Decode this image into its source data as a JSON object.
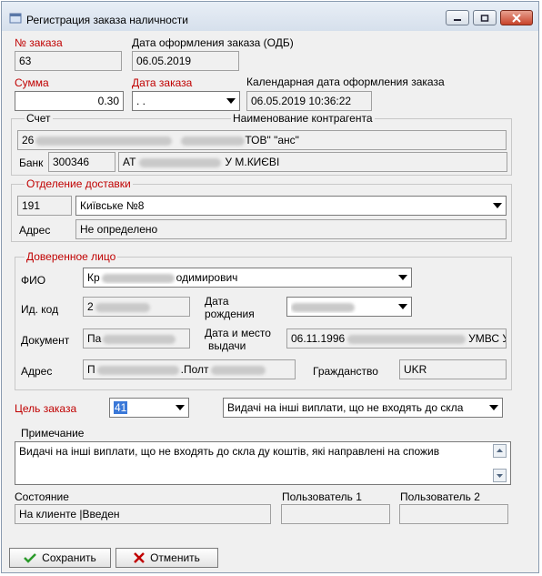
{
  "window": {
    "title": "Регистрация заказа наличности"
  },
  "order": {
    "number_label": "№ заказа",
    "number": "63",
    "odb_date_label": "Дата оформления заказа (ОДБ)",
    "odb_date": "06.05.2019",
    "sum_label": "Сумма",
    "sum": "0.30",
    "date_label": "Дата заказа",
    "date": ". .",
    "calendar_date_label": "Календарная дата оформления заказа",
    "calendar_date": "06.05.2019 10:36:22"
  },
  "account": {
    "legend": "Счет",
    "counterparty_label": "Наименование контрагента",
    "number_visible": "26",
    "counterparty_suffix": "ТОВ\" \"анс\"",
    "bank_label": "Банк",
    "bank_code": "300346",
    "bank_name_prefix": "АТ",
    "bank_name_suffix": "У М.КИЄВІ"
  },
  "delivery": {
    "legend": "Отделение доставки",
    "code": "191",
    "branch": "Київське №8",
    "address_label": "Адрес",
    "address": "Не определено"
  },
  "proxy": {
    "legend": "Доверенное лицо",
    "fio_label": "ФИО",
    "fio_prefix": "Кр",
    "fio_suffix": "одимирович",
    "id_label": "Ид. код",
    "id_prefix": "2",
    "birth_label_1": "Дата",
    "birth_label_2": "рождения",
    "doc_label": "Документ",
    "doc_prefix": "Па",
    "issue_label_1": "Дата и место",
    "issue_label_2": "выдачи",
    "issue_prefix": "06.11.1996",
    "issue_suffix": "УМВС У",
    "address_label": "Адрес",
    "address_prefix": "П",
    "address_middle": ".Полт",
    "citizenship_label": "Гражданство",
    "citizenship": "UKR"
  },
  "purpose": {
    "label": "Цель заказа",
    "code": "41",
    "description": "Видачі на інші виплати, що не входять до скла"
  },
  "note": {
    "label": "Примечание",
    "text": "Видачі на інші виплати, що не входять до скла   ду коштів, які направлені на спожив"
  },
  "status": {
    "state_label": "Состояние",
    "state": "На клиенте |Введен",
    "user1_label": "Пользователь 1",
    "user1": "",
    "user2_label": "Пользователь 2",
    "user2": ""
  },
  "buttons": {
    "save": "Сохранить",
    "cancel": "Отменить"
  }
}
